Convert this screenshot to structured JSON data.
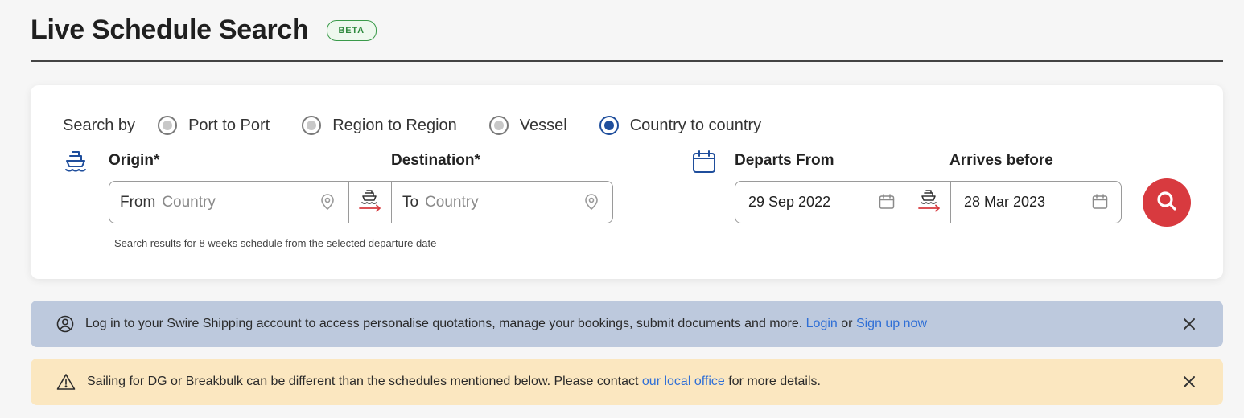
{
  "header": {
    "title": "Live Schedule Search",
    "badge": "BETA"
  },
  "search": {
    "search_by_label": "Search by",
    "options": [
      {
        "label": "Port to Port",
        "checked": false
      },
      {
        "label": "Region to Region",
        "checked": false
      },
      {
        "label": "Vessel",
        "checked": false
      },
      {
        "label": "Country to country",
        "checked": true
      }
    ],
    "origin_label": "Origin*",
    "destination_label": "Destination*",
    "departs_label": "Departs From",
    "arrives_label": "Arrives before",
    "from_prefix": "From",
    "from_placeholder": "Country",
    "to_prefix": "To",
    "to_placeholder": "Country",
    "depart_date": "29 Sep 2022",
    "arrive_date": "28 Mar 2023",
    "hint": "Search results for 8 weeks schedule from the selected departure date"
  },
  "banners": {
    "login": {
      "text": "Log in to your Swire Shipping account to access personalise quotations, manage your bookings, submit documents and more.",
      "login_link": "Login",
      "or": "or",
      "signup_link": "Sign up now"
    },
    "warning": {
      "text": "Sailing for DG or Breakbulk can be different than the schedules mentioned below. Please contact",
      "link": "our local office",
      "suffix": "for more details."
    }
  },
  "colors": {
    "accent_blue": "#1f4e9c",
    "search_red": "#d83a3f",
    "beta_green": "#2f8a3e",
    "link_blue": "#2f6fd6",
    "login_banner_bg": "#bdc9dd",
    "warning_banner_bg": "#fbe7c0"
  },
  "icons": {
    "origin": "ship-icon",
    "dates": "calendar-icon",
    "search": "search-icon",
    "login_banner": "user-icon",
    "warning_banner": "warning-icon",
    "close": "close-icon",
    "location": "location-pin-icon"
  }
}
